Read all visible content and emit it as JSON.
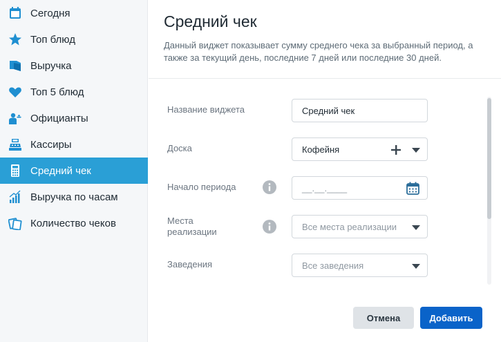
{
  "sidebar": {
    "items": [
      {
        "label": "Сегодня",
        "icon": "calendar-icon"
      },
      {
        "label": "Топ блюд",
        "icon": "star-icon"
      },
      {
        "label": "Выручка",
        "icon": "book-icon"
      },
      {
        "label": "Топ 5 блюд",
        "icon": "heart-icon"
      },
      {
        "label": "Официанты",
        "icon": "waiter-icon"
      },
      {
        "label": "Кассиры",
        "icon": "cash-register-icon"
      },
      {
        "label": "Средний чек",
        "icon": "calculator-icon"
      },
      {
        "label": "Выручка по часам",
        "icon": "bar-chart-icon"
      },
      {
        "label": "Количество чеков",
        "icon": "receipts-icon"
      }
    ],
    "active_index": 6
  },
  "dialog": {
    "title": "Средний чек",
    "description": "Данный виджет показывает сумму среднего чека за выбранный период, а также за текущий день, последние 7 дней или последние 30 дней.",
    "fields": {
      "name": {
        "label": "Название виджета",
        "value": "Средний чек"
      },
      "board": {
        "label": "Доска",
        "value": "Кофейня"
      },
      "period_start": {
        "label": "Начало периода",
        "placeholder": "__.__.____"
      },
      "places": {
        "label_line1": "Места",
        "label_line2": "реализации",
        "placeholder": "Все места реализации"
      },
      "venues": {
        "label": "Заведения",
        "placeholder": "Все заведения"
      }
    },
    "buttons": {
      "cancel": "Отмена",
      "add": "Добавить"
    }
  },
  "colors": {
    "accent": "#2a9fd6",
    "primary_button": "#0a63c9",
    "icon_blue": "#1f8fd1"
  }
}
